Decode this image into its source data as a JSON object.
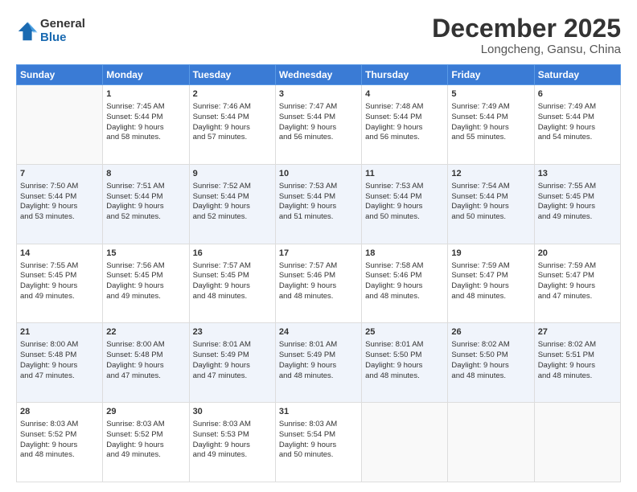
{
  "header": {
    "logo_general": "General",
    "logo_blue": "Blue",
    "month_title": "December 2025",
    "location": "Longcheng, Gansu, China"
  },
  "days_of_week": [
    "Sunday",
    "Monday",
    "Tuesday",
    "Wednesday",
    "Thursday",
    "Friday",
    "Saturday"
  ],
  "weeks": [
    [
      {
        "day": "",
        "text": ""
      },
      {
        "day": "1",
        "text": "Sunrise: 7:45 AM\nSunset: 5:44 PM\nDaylight: 9 hours\nand 58 minutes."
      },
      {
        "day": "2",
        "text": "Sunrise: 7:46 AM\nSunset: 5:44 PM\nDaylight: 9 hours\nand 57 minutes."
      },
      {
        "day": "3",
        "text": "Sunrise: 7:47 AM\nSunset: 5:44 PM\nDaylight: 9 hours\nand 56 minutes."
      },
      {
        "day": "4",
        "text": "Sunrise: 7:48 AM\nSunset: 5:44 PM\nDaylight: 9 hours\nand 56 minutes."
      },
      {
        "day": "5",
        "text": "Sunrise: 7:49 AM\nSunset: 5:44 PM\nDaylight: 9 hours\nand 55 minutes."
      },
      {
        "day": "6",
        "text": "Sunrise: 7:49 AM\nSunset: 5:44 PM\nDaylight: 9 hours\nand 54 minutes."
      }
    ],
    [
      {
        "day": "7",
        "text": "Sunrise: 7:50 AM\nSunset: 5:44 PM\nDaylight: 9 hours\nand 53 minutes."
      },
      {
        "day": "8",
        "text": "Sunrise: 7:51 AM\nSunset: 5:44 PM\nDaylight: 9 hours\nand 52 minutes."
      },
      {
        "day": "9",
        "text": "Sunrise: 7:52 AM\nSunset: 5:44 PM\nDaylight: 9 hours\nand 52 minutes."
      },
      {
        "day": "10",
        "text": "Sunrise: 7:53 AM\nSunset: 5:44 PM\nDaylight: 9 hours\nand 51 minutes."
      },
      {
        "day": "11",
        "text": "Sunrise: 7:53 AM\nSunset: 5:44 PM\nDaylight: 9 hours\nand 50 minutes."
      },
      {
        "day": "12",
        "text": "Sunrise: 7:54 AM\nSunset: 5:44 PM\nDaylight: 9 hours\nand 50 minutes."
      },
      {
        "day": "13",
        "text": "Sunrise: 7:55 AM\nSunset: 5:45 PM\nDaylight: 9 hours\nand 49 minutes."
      }
    ],
    [
      {
        "day": "14",
        "text": "Sunrise: 7:55 AM\nSunset: 5:45 PM\nDaylight: 9 hours\nand 49 minutes."
      },
      {
        "day": "15",
        "text": "Sunrise: 7:56 AM\nSunset: 5:45 PM\nDaylight: 9 hours\nand 49 minutes."
      },
      {
        "day": "16",
        "text": "Sunrise: 7:57 AM\nSunset: 5:45 PM\nDaylight: 9 hours\nand 48 minutes."
      },
      {
        "day": "17",
        "text": "Sunrise: 7:57 AM\nSunset: 5:46 PM\nDaylight: 9 hours\nand 48 minutes."
      },
      {
        "day": "18",
        "text": "Sunrise: 7:58 AM\nSunset: 5:46 PM\nDaylight: 9 hours\nand 48 minutes."
      },
      {
        "day": "19",
        "text": "Sunrise: 7:59 AM\nSunset: 5:47 PM\nDaylight: 9 hours\nand 48 minutes."
      },
      {
        "day": "20",
        "text": "Sunrise: 7:59 AM\nSunset: 5:47 PM\nDaylight: 9 hours\nand 47 minutes."
      }
    ],
    [
      {
        "day": "21",
        "text": "Sunrise: 8:00 AM\nSunset: 5:48 PM\nDaylight: 9 hours\nand 47 minutes."
      },
      {
        "day": "22",
        "text": "Sunrise: 8:00 AM\nSunset: 5:48 PM\nDaylight: 9 hours\nand 47 minutes."
      },
      {
        "day": "23",
        "text": "Sunrise: 8:01 AM\nSunset: 5:49 PM\nDaylight: 9 hours\nand 47 minutes."
      },
      {
        "day": "24",
        "text": "Sunrise: 8:01 AM\nSunset: 5:49 PM\nDaylight: 9 hours\nand 48 minutes."
      },
      {
        "day": "25",
        "text": "Sunrise: 8:01 AM\nSunset: 5:50 PM\nDaylight: 9 hours\nand 48 minutes."
      },
      {
        "day": "26",
        "text": "Sunrise: 8:02 AM\nSunset: 5:50 PM\nDaylight: 9 hours\nand 48 minutes."
      },
      {
        "day": "27",
        "text": "Sunrise: 8:02 AM\nSunset: 5:51 PM\nDaylight: 9 hours\nand 48 minutes."
      }
    ],
    [
      {
        "day": "28",
        "text": "Sunrise: 8:03 AM\nSunset: 5:52 PM\nDaylight: 9 hours\nand 48 minutes."
      },
      {
        "day": "29",
        "text": "Sunrise: 8:03 AM\nSunset: 5:52 PM\nDaylight: 9 hours\nand 49 minutes."
      },
      {
        "day": "30",
        "text": "Sunrise: 8:03 AM\nSunset: 5:53 PM\nDaylight: 9 hours\nand 49 minutes."
      },
      {
        "day": "31",
        "text": "Sunrise: 8:03 AM\nSunset: 5:54 PM\nDaylight: 9 hours\nand 50 minutes."
      },
      {
        "day": "",
        "text": ""
      },
      {
        "day": "",
        "text": ""
      },
      {
        "day": "",
        "text": ""
      }
    ]
  ]
}
